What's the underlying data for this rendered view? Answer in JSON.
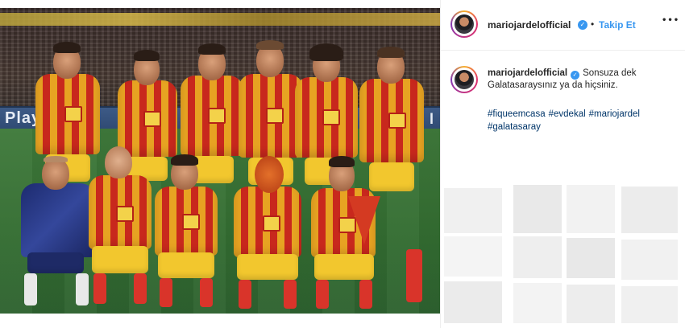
{
  "photo": {
    "adboard_left": "Play",
    "adboard_right": "l"
  },
  "header": {
    "username": "mariojardelofficial",
    "verified_badge": "✓",
    "separator": "•",
    "follow_label": "Takip Et",
    "more_icon": "•••"
  },
  "caption": {
    "username": "mariojardelofficial",
    "verified_badge": "✓",
    "text": "Sonsuza dek Galatasaraysınız ya da hiçsiniz.",
    "hashtags": [
      "#fiqueemcasa",
      "#evdekal",
      "#mariojardel",
      "#galatasaray"
    ]
  },
  "colors": {
    "accent": "#3897f0",
    "hashtag": "#003569",
    "jersey_yellow": "#e7a322",
    "jersey_red": "#c8281d"
  }
}
